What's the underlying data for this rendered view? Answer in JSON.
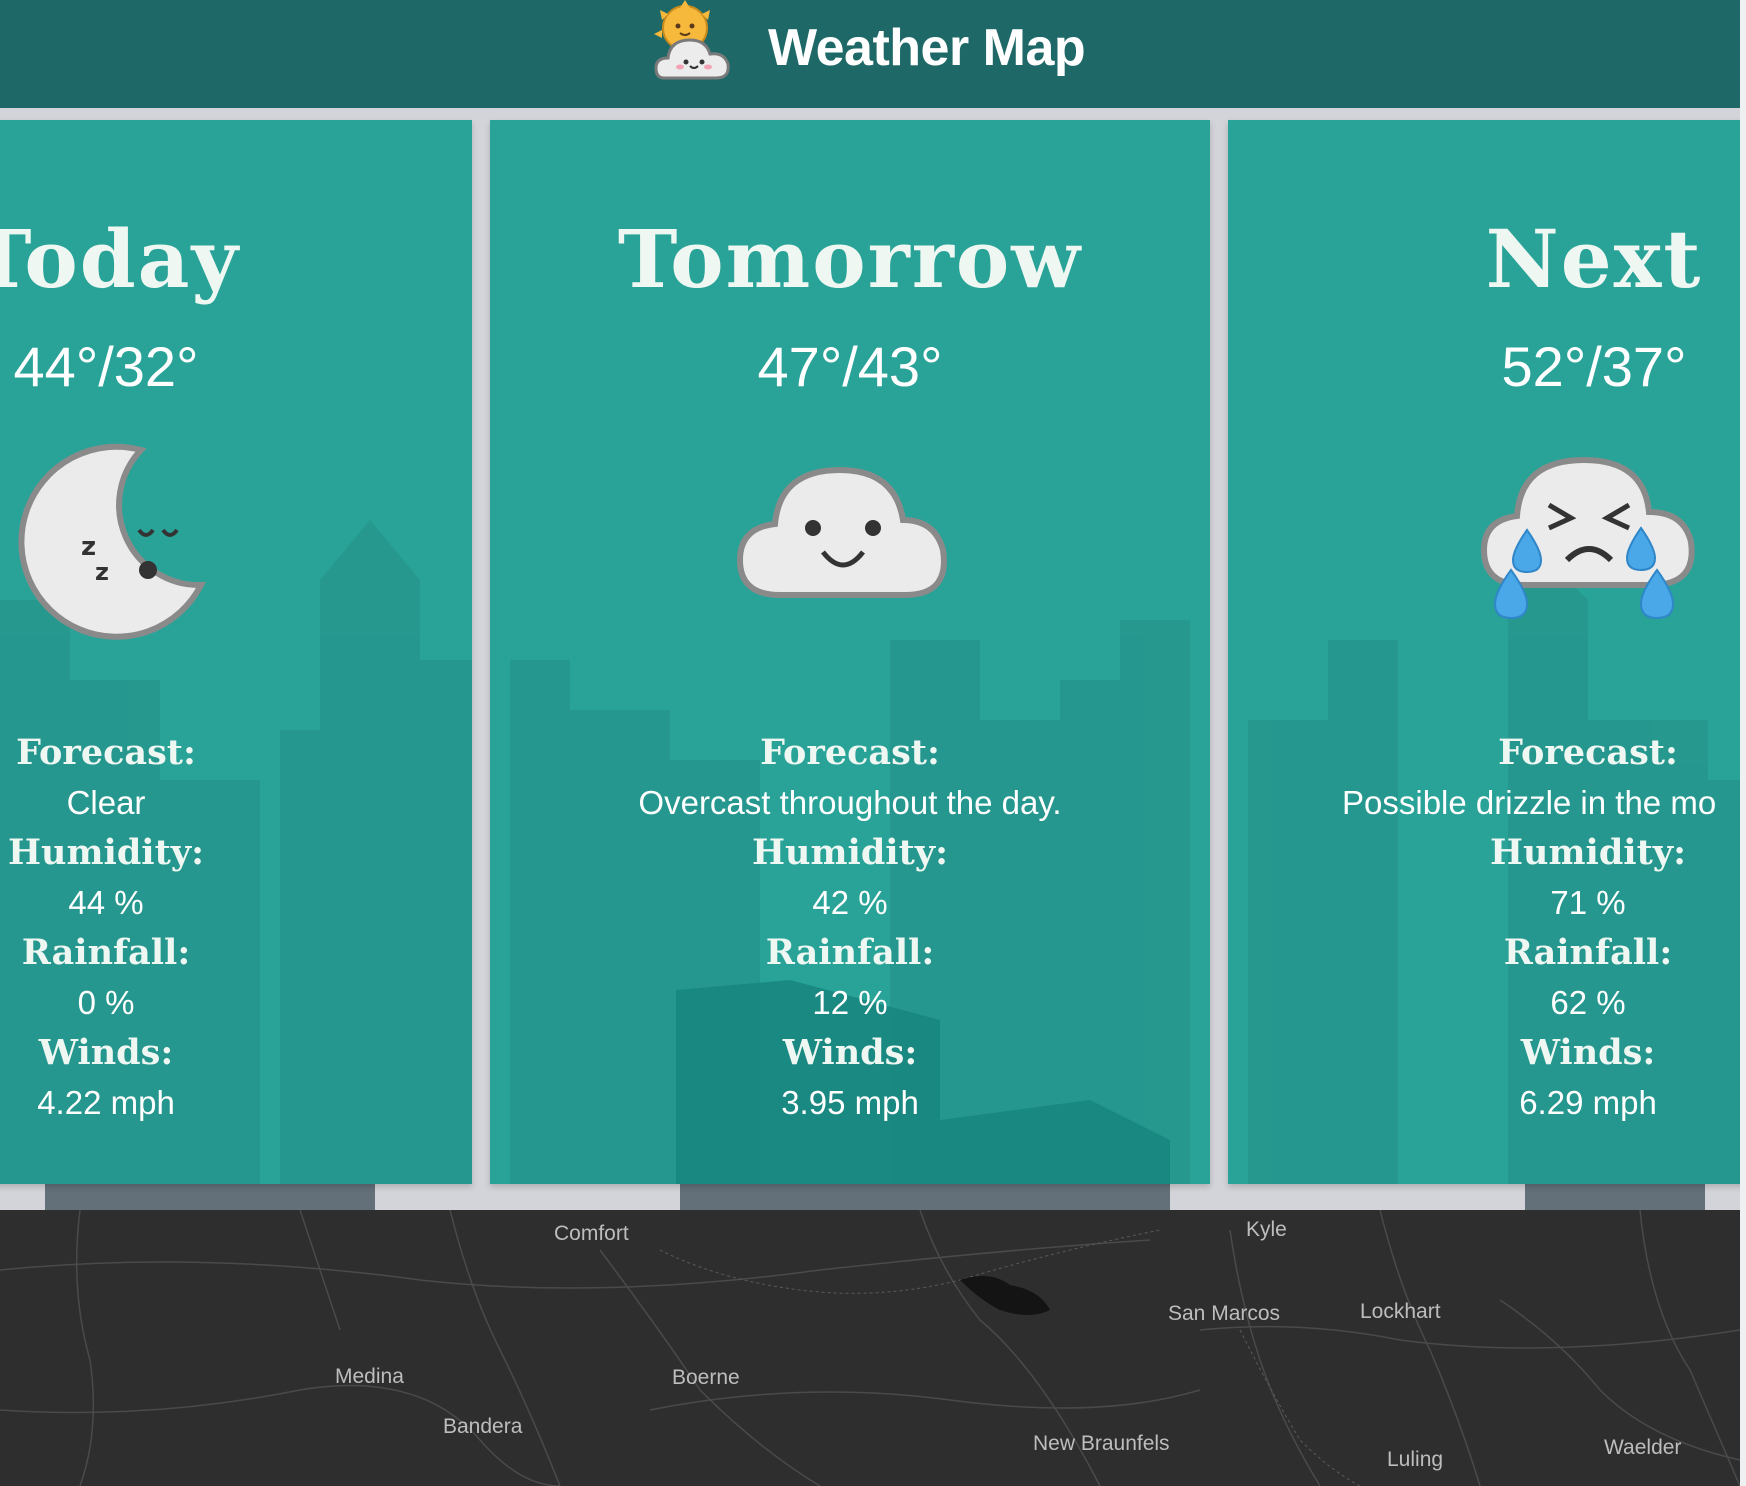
{
  "header": {
    "title": "Weather Map",
    "logo_icon": "sun-behind-cloud-icon"
  },
  "colors": {
    "header_bg": "#1e6967",
    "card_bg": "#29a398",
    "map_bg": "#2e2e2e"
  },
  "cards": [
    {
      "title": "Today",
      "temp": "44°/32°",
      "icon": "sleeping-moon-icon",
      "forecast_label": "Forecast:",
      "forecast": "Clear",
      "humidity_label": "Humidity:",
      "humidity": "44 %",
      "rainfall_label": "Rainfall:",
      "rainfall": "0 %",
      "winds_label": "Winds:",
      "winds": "4.22 mph"
    },
    {
      "title": "Tomorrow",
      "temp": "47°/43°",
      "icon": "smiling-cloud-icon",
      "forecast_label": "Forecast:",
      "forecast": "Overcast throughout the day.",
      "humidity_label": "Humidity:",
      "humidity": "42 %",
      "rainfall_label": "Rainfall:",
      "rainfall": "12 %",
      "winds_label": "Winds:",
      "winds": "3.95 mph"
    },
    {
      "title": "Next",
      "temp": "52°/37°",
      "icon": "crying-rain-cloud-icon",
      "forecast_label": "Forecast:",
      "forecast": "Possible drizzle in the mo",
      "humidity_label": "Humidity:",
      "humidity": "71 %",
      "rainfall_label": "Rainfall:",
      "rainfall": "62 %",
      "winds_label": "Winds:",
      "winds": "6.29 mph"
    }
  ],
  "map": {
    "places": [
      "Comfort",
      "Kyle",
      "San Marcos",
      "Lockhart",
      "Medina",
      "Boerne",
      "Bandera",
      "New Braunfels",
      "Luling",
      "Waelder"
    ]
  }
}
